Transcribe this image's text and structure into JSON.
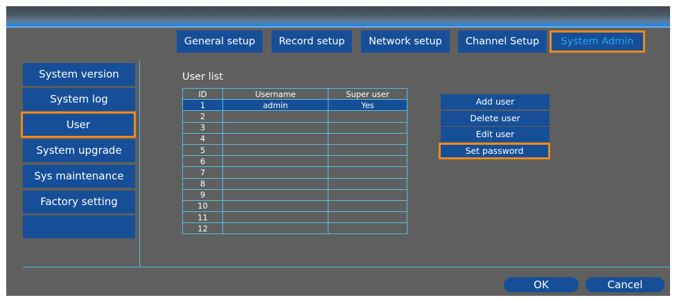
{
  "tabs": [
    {
      "label": "General setup",
      "active": false
    },
    {
      "label": "Record setup",
      "active": false
    },
    {
      "label": "Network setup",
      "active": false
    },
    {
      "label": "Channel Setup",
      "active": false
    },
    {
      "label": "System Admin",
      "active": true
    }
  ],
  "sidebar": {
    "items": [
      {
        "label": "System version",
        "selected": false
      },
      {
        "label": "System log",
        "selected": false
      },
      {
        "label": "User",
        "selected": true
      },
      {
        "label": "System upgrade",
        "selected": false
      },
      {
        "label": "Sys maintenance",
        "selected": false
      },
      {
        "label": "Factory setting",
        "selected": false
      },
      {
        "label": "",
        "selected": false
      }
    ]
  },
  "user_list": {
    "title": "User list",
    "columns": [
      "ID",
      "Username",
      "Super user"
    ],
    "rows": [
      {
        "id": "1",
        "username": "admin",
        "super_user": "Yes",
        "selected": true
      },
      {
        "id": "2",
        "username": "",
        "super_user": ""
      },
      {
        "id": "3",
        "username": "",
        "super_user": ""
      },
      {
        "id": "4",
        "username": "",
        "super_user": ""
      },
      {
        "id": "5",
        "username": "",
        "super_user": ""
      },
      {
        "id": "6",
        "username": "",
        "super_user": ""
      },
      {
        "id": "7",
        "username": "",
        "super_user": ""
      },
      {
        "id": "8",
        "username": "",
        "super_user": ""
      },
      {
        "id": "9",
        "username": "",
        "super_user": ""
      },
      {
        "id": "10",
        "username": "",
        "super_user": ""
      },
      {
        "id": "11",
        "username": "",
        "super_user": ""
      },
      {
        "id": "12",
        "username": "",
        "super_user": ""
      }
    ]
  },
  "actions": {
    "add_user": "Add user",
    "delete_user": "Delete user",
    "edit_user": "Edit user",
    "set_password": "Set password"
  },
  "footer": {
    "ok": "OK",
    "cancel": "Cancel"
  },
  "colors": {
    "panel_bg": "#5f5f5f",
    "button_blue": "#164f97",
    "highlight_orange": "#ef8a1a",
    "active_tab_text": "#2aa2f5",
    "grid_line": "#56c4e4"
  }
}
